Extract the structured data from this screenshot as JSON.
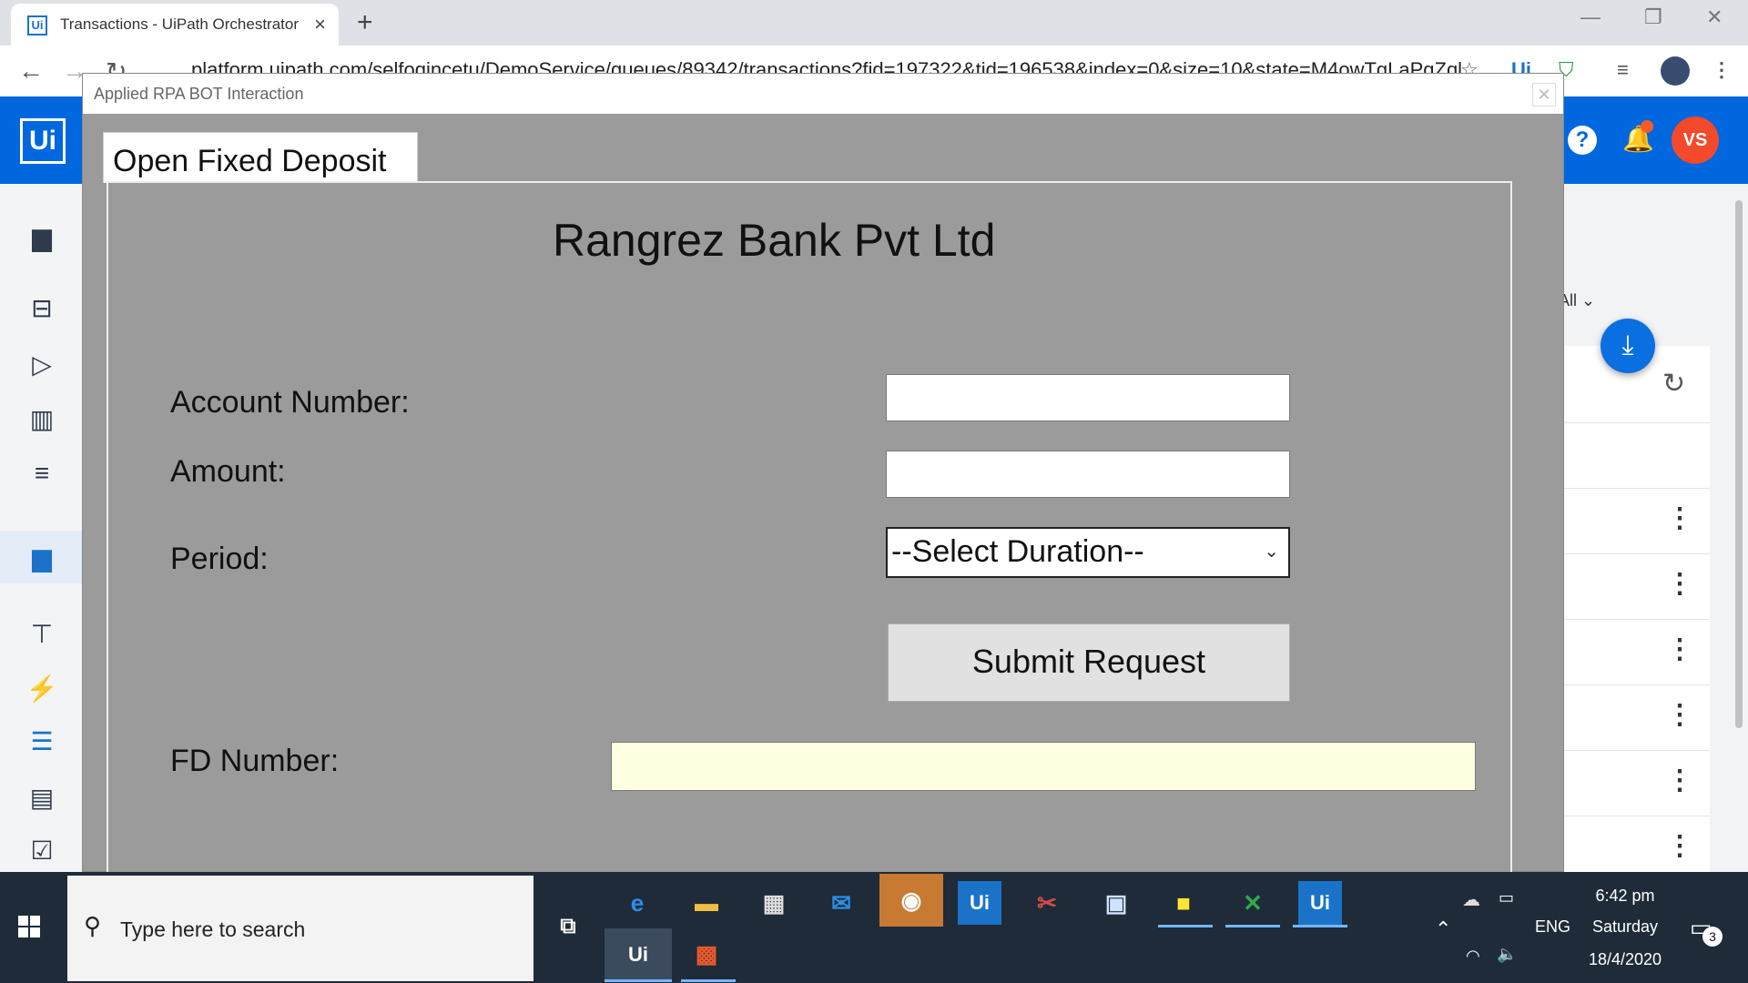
{
  "browser": {
    "tab_title": "Transactions - UiPath Orchestrator",
    "tab_favicon": "Ui",
    "url": "platform.uipath.com/selfoqincetu/DemoService/queues/89342/transactions?fid=197322&tid=196538&index=0&size=10&state=M4owTgLaPqZql"
  },
  "orchestrator": {
    "logo": "Ui",
    "user_initials": "VS",
    "filter_label": "All",
    "accent": "#0067df"
  },
  "dialog": {
    "title": "Applied RPA BOT Interaction",
    "tab_label": "Open Fixed Deposit",
    "bank_name": "Rangrez Bank Pvt Ltd",
    "account_label": "Account Number:",
    "account_value": "",
    "amount_label": "Amount:",
    "amount_value": "",
    "period_label": "Period:",
    "period_selected": "--Select Duration--",
    "submit_label": "Submit Request",
    "fd_label": "FD Number:",
    "fd_value": ""
  },
  "taskbar": {
    "search_placeholder": "Type here to search",
    "language": "ENG",
    "time": "6:42 pm",
    "day": "Saturday",
    "date": "18/4/2020",
    "notification_count": "3",
    "apps": [
      "edge-icon",
      "file-explorer-icon",
      "store-icon",
      "mail-icon",
      "chrome-icon",
      "uipath-studio-icon",
      "snipping-icon",
      "window-icon",
      "sticky-notes-icon",
      "excel-icon",
      "uipath-assistant-icon",
      "uipath-robot-icon",
      "app-icon"
    ]
  }
}
